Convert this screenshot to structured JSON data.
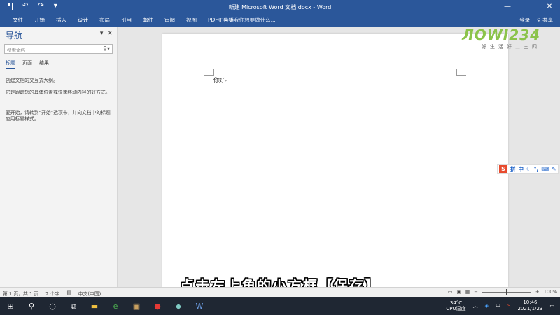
{
  "titlebar": {
    "title": "新建 Microsoft Word 文档.docx - Word",
    "undo": "↶",
    "redo": "↷",
    "customize": "▾"
  },
  "window_controls": {
    "minimize": "—",
    "restore": "❐",
    "close": "✕"
  },
  "ribbon": {
    "tabs": [
      "文件",
      "开始",
      "插入",
      "设计",
      "布局",
      "引用",
      "邮件",
      "审阅",
      "视图",
      "PDF工具集"
    ],
    "tell_me": "告诉我你想要做什么...",
    "sign_in": "登录",
    "share": "共享"
  },
  "nav": {
    "title": "导航",
    "search_placeholder": "搜索文档",
    "tabs": [
      "标题",
      "页面",
      "结果"
    ],
    "msg1": "创建文档的交互式大纲。",
    "msg2": "它是跟踪您的具体位置或快速移动内容的好方式。",
    "msg3": "要开始，请转到“开始”选项卡，并向文档中的标题应用标题样式。"
  },
  "document": {
    "text": "你好",
    "para_mark": "↵"
  },
  "logo": {
    "main": "ЛОWI234",
    "sub": "好生活好二三四"
  },
  "ime": {
    "s": "S",
    "pin": "拼",
    "zh": "中"
  },
  "subtitle": "点击左上角的小方框【保存】",
  "status": {
    "page": "第 1 页，共 1 页",
    "words": "2 个字",
    "lang": "中文(中国)",
    "zoom": "100%"
  },
  "taskbar": {
    "temp": "34°C",
    "cpu": "CPU温度",
    "time": "10:46",
    "date": "2021/1/23"
  },
  "colors": {
    "word_blue": "#2b579a",
    "nav_bg": "#f3f3f3",
    "doc_bg": "#e6e6e6",
    "taskbar": "#1f2733"
  }
}
